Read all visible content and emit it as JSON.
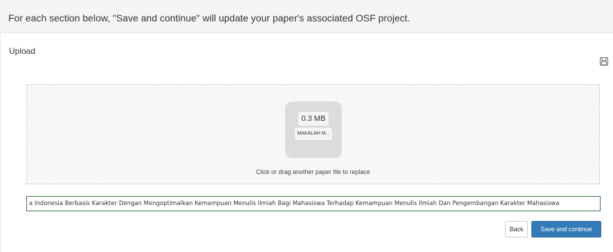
{
  "banner": {
    "text": "For each section below, \"Save and continue\" will update your paper's associated OSF project."
  },
  "section": {
    "title": "Upload",
    "save_icon": "floppy-disk-icon"
  },
  "upload": {
    "file_size": "0.3 MB",
    "file_name": "MAKALAH M...",
    "replace_hint": "Click or drag another paper file to replace"
  },
  "title_field": {
    "value": "a Indonesia Berbasis Karakter Dengan Mengoptimalkan Kemampuan Menulis Ilmiah Bagi Mahasiswa Terhadap Kemampuan Menulis Ilmiah Dan Pengembangan Karakter Mahasiswa"
  },
  "actions": {
    "back_label": "Back",
    "save_label": "Save and continue"
  },
  "colors": {
    "primary": "#337ab7",
    "input_border": "#3c763d"
  }
}
